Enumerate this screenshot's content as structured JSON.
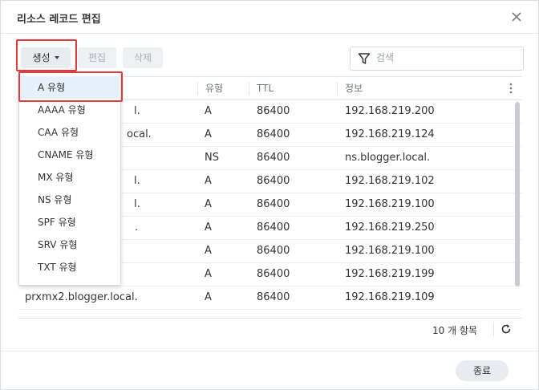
{
  "dialog": {
    "title": "리소스 레코드 편집"
  },
  "toolbar": {
    "create_label": "생성",
    "edit_label": "편집",
    "delete_label": "삭제",
    "search_placeholder": "검색"
  },
  "table": {
    "columns": [
      "유형",
      "TTL",
      "정보"
    ],
    "rows": [
      {
        "name": "",
        "type": "",
        "ttl": "",
        "info": ""
      },
      {
        "name": "l.",
        "type": "A",
        "ttl": "86400",
        "info": "192.168.219.200"
      },
      {
        "name": "ocal.",
        "type": "A",
        "ttl": "86400",
        "info": "192.168.219.124"
      },
      {
        "name": "",
        "type": "NS",
        "ttl": "86400",
        "info": "ns.blogger.local."
      },
      {
        "name": "l.",
        "type": "A",
        "ttl": "86400",
        "info": "192.168.219.102"
      },
      {
        "name": "l.",
        "type": "A",
        "ttl": "86400",
        "info": "192.168.219.100"
      },
      {
        "name": ".",
        "type": "A",
        "ttl": "86400",
        "info": "192.168.219.250"
      },
      {
        "name": "",
        "type": "A",
        "ttl": "86400",
        "info": "192.168.219.100"
      },
      {
        "name": "",
        "type": "A",
        "ttl": "86400",
        "info": "192.168.219.199"
      },
      {
        "name": "prxmx2.blogger.local.",
        "type": "A",
        "ttl": "86400",
        "info": "192.168.219.109"
      }
    ],
    "item_count": "10 개 항목"
  },
  "dropdown": {
    "items": [
      "A 유형",
      "AAAA 유형",
      "CAA 유형",
      "CNAME 유형",
      "MX 유형",
      "NS 유형",
      "SPF 유형",
      "SRV 유형",
      "TXT 유형"
    ],
    "selected": "A 유형"
  },
  "footer": {
    "close_label": "종료"
  },
  "colors": {
    "highlight_box": "#e03c3c",
    "selected_item_bg": "#e6effa",
    "button_bg": "#e8ecf0"
  },
  "icons": {
    "close": "close-icon",
    "filter": "filter-icon",
    "refresh": "refresh-icon",
    "column_menu": "more-vertical-icon"
  }
}
